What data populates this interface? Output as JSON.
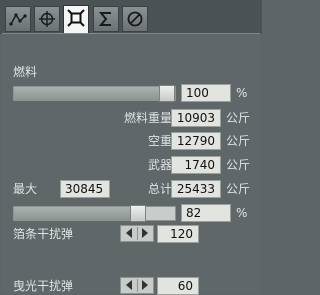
{
  "tabs": [
    {
      "icon": "waypoint-route-icon"
    },
    {
      "icon": "crosshair-icon"
    },
    {
      "icon": "loadout-icon"
    },
    {
      "icon": "sigma-icon"
    },
    {
      "icon": "prohibited-icon"
    }
  ],
  "fuel": {
    "label": "燃料",
    "percent_value": "100",
    "percent_unit": "%",
    "slider_level_percent": 100
  },
  "weights": {
    "fuel_weight": {
      "label": "燃料重量",
      "value": "10903",
      "unit": "公斤"
    },
    "empty_weight": {
      "label": "空重",
      "value": "12790",
      "unit": "公斤"
    },
    "weapons": {
      "label": "武器",
      "value": "1740",
      "unit": "公斤"
    },
    "max": {
      "label": "最大",
      "value": "30845"
    },
    "total": {
      "label": "总计",
      "value": "25433",
      "unit": "公斤"
    }
  },
  "load": {
    "percent_value": "82",
    "percent_unit": "%",
    "slider_level_percent": 82
  },
  "countermeasures": {
    "chaff": {
      "label": "箔条干扰弹",
      "value": "120"
    },
    "flare": {
      "label": "曳光干扰弹",
      "value": "60"
    }
  }
}
